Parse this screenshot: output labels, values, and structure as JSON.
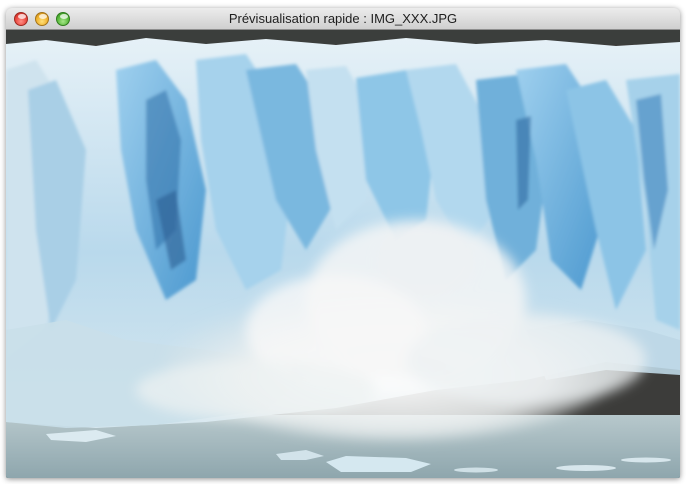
{
  "window": {
    "title": "Prévisualisation rapide : IMG_XXX.JPG",
    "controls": {
      "close": "close-icon",
      "minimize": "minimize-icon",
      "zoom": "zoom-icon"
    }
  },
  "preview": {
    "subject": "glacier-calving-photo"
  },
  "colors": {
    "ice_light": "#dfeef7",
    "ice_blue": "#7fbde0",
    "ice_deep": "#3d8cc6",
    "water": "#9fb6bd",
    "spray": "#f2f4f4"
  }
}
